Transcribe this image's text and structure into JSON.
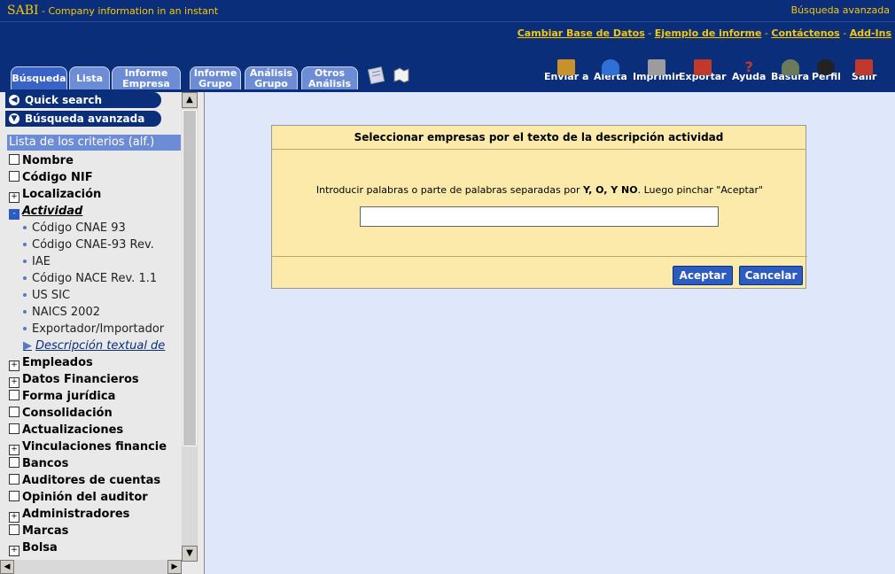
{
  "header": {
    "brand": "SABI",
    "tagline": "- Company information in an instant",
    "mode": "Búsqueda avanzada"
  },
  "links": [
    "Cambiar Base de Datos",
    "Ejemplo de informe",
    "Contáctenos",
    "Add-Ins"
  ],
  "tabs": [
    {
      "label": "Búsqueda"
    },
    {
      "label": "Lista"
    },
    {
      "label": "Informe\nEmpresa"
    },
    {
      "label": "Informe\nGrupo"
    },
    {
      "label": "Análisis\nGrupo"
    },
    {
      "label": "Otros\nAnálisis"
    }
  ],
  "tools": [
    "Enviar a",
    "Alerta",
    "Imprimir",
    "Exportar",
    "Ayuda",
    "Basura",
    "Perfil",
    "Salir"
  ],
  "sidebar": {
    "quick_search": "Quick search",
    "advanced_search": "Búsqueda avanzada",
    "criteria_title": "Lista de los criterios (alf.)",
    "criteria": [
      {
        "label": "Nombre",
        "mark": ""
      },
      {
        "label": "Código NIF",
        "mark": ""
      },
      {
        "label": "Localización",
        "mark": "+"
      },
      {
        "label": "Actividad",
        "mark": "-"
      }
    ],
    "activity_items": [
      "Código CNAE 93",
      "Código CNAE-93 Rev.",
      "IAE",
      "Código NACE Rev. 1.1",
      "US SIC",
      "NAICS 2002",
      "Exportador/Importador",
      "Descripción textual de"
    ],
    "criteria_more": [
      {
        "label": "Empleados",
        "mark": "+"
      },
      {
        "label": "Datos Financieros",
        "mark": "+"
      },
      {
        "label": "Forma jurídica",
        "mark": ""
      },
      {
        "label": "Consolidación",
        "mark": ""
      },
      {
        "label": "Actualizaciones",
        "mark": ""
      },
      {
        "label": "Vinculaciones financie",
        "mark": "+"
      },
      {
        "label": "Bancos",
        "mark": ""
      },
      {
        "label": "Auditores de cuentas",
        "mark": ""
      },
      {
        "label": "Opinión del auditor",
        "mark": ""
      },
      {
        "label": "Administradores",
        "mark": "+"
      },
      {
        "label": "Marcas",
        "mark": ""
      },
      {
        "label": "Bolsa",
        "mark": "+"
      }
    ]
  },
  "dialog": {
    "title": "Seleccionar empresas por el texto de la descripción actividad",
    "instruction_pre": "Introducir palabras o parte de palabras separadas por ",
    "instruction_ops": "Y, O, Y NO",
    "instruction_post": ". Luego pinchar \"Aceptar\"",
    "input_value": "",
    "accept": "Aceptar",
    "cancel": "Cancelar"
  },
  "colors": {
    "header_bg": "#0b2e7a",
    "accent_yellow": "#f5c800",
    "dialog_bg": "#fbeaa9",
    "main_bg": "#dfe8fa",
    "button": "#2c5cc0"
  }
}
